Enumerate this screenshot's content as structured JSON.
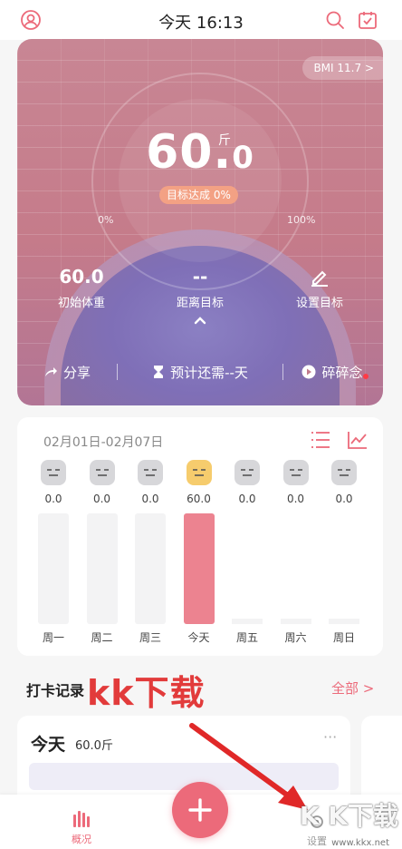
{
  "header": {
    "title": "今天 16:13"
  },
  "hero": {
    "bmi_label": "BMI 11.7",
    "weight": "60.",
    "weight_decimal": "0",
    "unit": "斤",
    "goal_badge": "目标达成 0%",
    "pct_left": "0%",
    "pct_right": "100%",
    "stats": {
      "initial_value": "60.0",
      "initial_label": "初始体重",
      "distance_value": "--",
      "distance_label": "距离目标",
      "set_goal_label": "设置目标"
    },
    "actions": {
      "share": "分享",
      "estimate": "预计还需--天",
      "notes": "碎碎念"
    },
    "goal_progress": 0
  },
  "week": {
    "range": "02月01日-02月07日",
    "days": [
      {
        "label": "周一",
        "value": "0.0",
        "today": false,
        "fill": 0
      },
      {
        "label": "周二",
        "value": "0.0",
        "today": false,
        "fill": 0
      },
      {
        "label": "周三",
        "value": "0.0",
        "today": false,
        "fill": 0
      },
      {
        "label": "今天",
        "value": "60.0",
        "today": true,
        "fill": 1
      },
      {
        "label": "周五",
        "value": "0.0",
        "today": false,
        "fill": 0
      },
      {
        "label": "周六",
        "value": "0.0",
        "today": false,
        "fill": 0
      },
      {
        "label": "周日",
        "value": "0.0",
        "today": false,
        "fill": 0
      }
    ]
  },
  "records": {
    "title": "打卡记录",
    "all_link": "全部 >",
    "card_day": "今天",
    "card_weight": "60.0斤"
  },
  "overlays": {
    "watermark_big": "kk下载",
    "watermark_corner": "K K下载",
    "watermark_url": "www.kkx.net"
  },
  "tabbar": {
    "overview_label": "概况",
    "settings_label": "设置"
  },
  "colors": {
    "accent": "#ec6a7a",
    "today_face": "#f6cc6d"
  }
}
